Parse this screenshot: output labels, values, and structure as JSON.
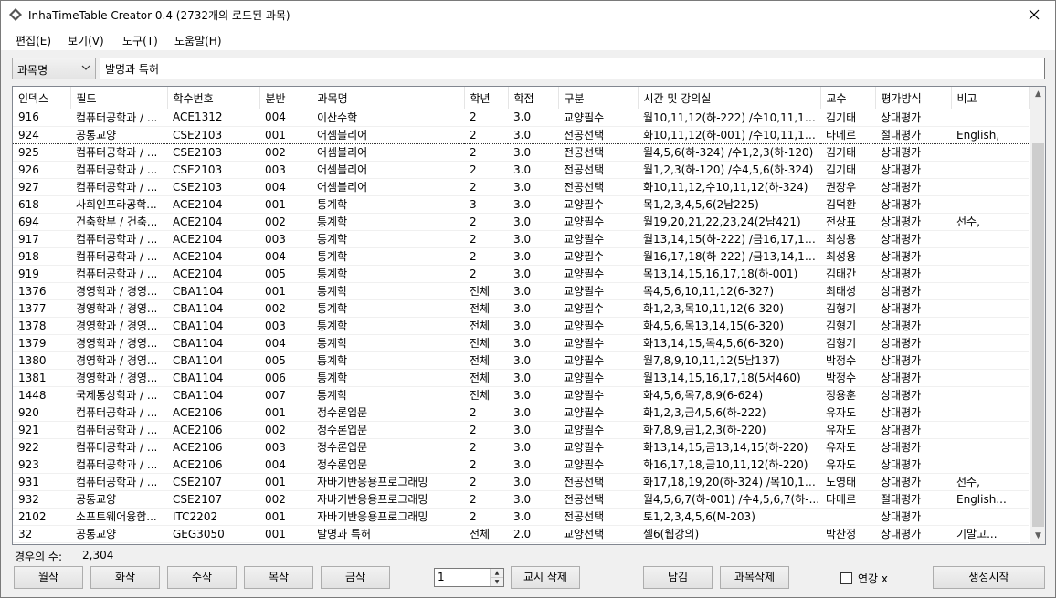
{
  "window": {
    "title": "InhaTimeTable Creator 0.4 (2732개의 로드된 과목)"
  },
  "menu": [
    "편집(E)",
    "보기(V)",
    "도구(T)",
    "도움말(H)"
  ],
  "search": {
    "field": "과목명",
    "value": "발명과 특허"
  },
  "table": {
    "columns": [
      "인덱스",
      "필드",
      "학수번호",
      "분반",
      "과목명",
      "학년",
      "학점",
      "구분",
      "시간 및 강의실",
      "교수",
      "평가방식",
      "비고"
    ],
    "rows": [
      [
        "916",
        "컴퓨터공학과 / ...",
        "ACE1312",
        "004",
        "이산수학",
        "2",
        "3.0",
        "교양필수",
        "월10,11,12(하-222) /수10,11,12(...",
        "김기태",
        "상대평가",
        ""
      ],
      [
        "924",
        "공통교양",
        "CSE2103",
        "001",
        "어셈블리어",
        "2",
        "3.0",
        "전공선택",
        "화10,11,12(하-001) /수10,11,12(...",
        "타메르",
        "절대평가",
        "English,"
      ],
      [
        "925",
        "컴퓨터공학과 / ...",
        "CSE2103",
        "002",
        "어셈블리어",
        "2",
        "3.0",
        "전공선택",
        "월4,5,6(하-324) /수1,2,3(하-120)",
        "김기태",
        "상대평가",
        ""
      ],
      [
        "926",
        "컴퓨터공학과 / ...",
        "CSE2103",
        "003",
        "어셈블리어",
        "2",
        "3.0",
        "전공선택",
        "월1,2,3(하-120) /수4,5,6(하-324)",
        "김기태",
        "상대평가",
        ""
      ],
      [
        "927",
        "컴퓨터공학과 / ...",
        "CSE2103",
        "004",
        "어셈블리어",
        "2",
        "3.0",
        "전공선택",
        "화10,11,12,수10,11,12(하-324)",
        "권장우",
        "상대평가",
        ""
      ],
      [
        "618",
        "사회인프라공학...",
        "ACE2104",
        "001",
        "통계학",
        "3",
        "3.0",
        "교양필수",
        "목1,2,3,4,5,6(2남225)",
        "김덕환",
        "상대평가",
        ""
      ],
      [
        "694",
        "건축학부 / 건축...",
        "ACE2104",
        "002",
        "통계학",
        "2",
        "3.0",
        "교양필수",
        "월19,20,21,22,23,24(2남421)",
        "전상표",
        "상대평가",
        "선수,"
      ],
      [
        "917",
        "컴퓨터공학과 / ...",
        "ACE2104",
        "003",
        "통계학",
        "2",
        "3.0",
        "교양필수",
        "월13,14,15(하-222) /금16,17,18(...",
        "최성용",
        "상대평가",
        ""
      ],
      [
        "918",
        "컴퓨터공학과 / ...",
        "ACE2104",
        "004",
        "통계학",
        "2",
        "3.0",
        "교양필수",
        "월16,17,18(하-222) /금13,14,15(...",
        "최성용",
        "상대평가",
        ""
      ],
      [
        "919",
        "컴퓨터공학과 / ...",
        "ACE2104",
        "005",
        "통계학",
        "2",
        "3.0",
        "교양필수",
        "목13,14,15,16,17,18(하-001)",
        "김태간",
        "상대평가",
        ""
      ],
      [
        "1376",
        "경영학과 / 경영...",
        "CBA1104",
        "001",
        "통계학",
        "전체",
        "3.0",
        "교양필수",
        "목4,5,6,10,11,12(6-327)",
        "최태성",
        "상대평가",
        ""
      ],
      [
        "1377",
        "경영학과 / 경영...",
        "CBA1104",
        "002",
        "통계학",
        "전체",
        "3.0",
        "교양필수",
        "화1,2,3,목10,11,12(6-320)",
        "김형기",
        "상대평가",
        ""
      ],
      [
        "1378",
        "경영학과 / 경영...",
        "CBA1104",
        "003",
        "통계학",
        "전체",
        "3.0",
        "교양필수",
        "화4,5,6,목13,14,15(6-320)",
        "김형기",
        "상대평가",
        ""
      ],
      [
        "1379",
        "경영학과 / 경영...",
        "CBA1104",
        "004",
        "통계학",
        "전체",
        "3.0",
        "교양필수",
        "화13,14,15,목4,5,6(6-320)",
        "김형기",
        "상대평가",
        ""
      ],
      [
        "1380",
        "경영학과 / 경영...",
        "CBA1104",
        "005",
        "통계학",
        "전체",
        "3.0",
        "교양필수",
        "월7,8,9,10,11,12(5남137)",
        "박정수",
        "상대평가",
        ""
      ],
      [
        "1381",
        "경영학과 / 경영...",
        "CBA1104",
        "006",
        "통계학",
        "전체",
        "3.0",
        "교양필수",
        "월13,14,15,16,17,18(5서460)",
        "박정수",
        "상대평가",
        ""
      ],
      [
        "1448",
        "국제통상학과 / ...",
        "CBA1104",
        "007",
        "통계학",
        "전체",
        "3.0",
        "교양필수",
        "화4,5,6,목7,8,9(6-624)",
        "정용훈",
        "상대평가",
        ""
      ],
      [
        "920",
        "컴퓨터공학과 / ...",
        "ACE2106",
        "001",
        "정수론입문",
        "2",
        "3.0",
        "교양필수",
        "화1,2,3,금4,5,6(하-222)",
        "유자도",
        "상대평가",
        ""
      ],
      [
        "921",
        "컴퓨터공학과 / ...",
        "ACE2106",
        "002",
        "정수론입문",
        "2",
        "3.0",
        "교양필수",
        "화7,8,9,금1,2,3(하-220)",
        "유자도",
        "상대평가",
        ""
      ],
      [
        "922",
        "컴퓨터공학과 / ...",
        "ACE2106",
        "003",
        "정수론입문",
        "2",
        "3.0",
        "교양필수",
        "화13,14,15,금13,14,15(하-220)",
        "유자도",
        "상대평가",
        ""
      ],
      [
        "923",
        "컴퓨터공학과 / ...",
        "ACE2106",
        "004",
        "정수론입문",
        "2",
        "3.0",
        "교양필수",
        "화16,17,18,금10,11,12(하-220)",
        "유자도",
        "상대평가",
        ""
      ],
      [
        "931",
        "컴퓨터공학과 / ...",
        "CSE2107",
        "001",
        "자바기반응용프로그래밍",
        "2",
        "3.0",
        "전공선택",
        "화17,18,19,20(하-324) /목10,11,...",
        "노영태",
        "상대평가",
        "선수,"
      ],
      [
        "932",
        "공통교양",
        "CSE2107",
        "002",
        "자바기반응용프로그래밍",
        "2",
        "3.0",
        "전공선택",
        "월4,5,6,7(하-001) /수4,5,6,7(하-...",
        "타메르",
        "절대평가",
        "English..."
      ],
      [
        "2102",
        "소프트웨어융합...",
        "ITC2202",
        "001",
        "자바기반응용프로그래밍",
        "2",
        "3.0",
        "전공선택",
        "토1,2,3,4,5,6(M-203)",
        "",
        "상대평가",
        ""
      ],
      [
        "32",
        "공통교양",
        "GEG3050",
        "001",
        "발명과 특허",
        "전체",
        "2.0",
        "교양선택",
        "셀6(웹강의)",
        "박찬정",
        "상대평가",
        "기말고..."
      ]
    ]
  },
  "status": {
    "count_label": "경우의 수:",
    "count_value": "2,304"
  },
  "buttons": {
    "mon": "월삭",
    "tue": "화삭",
    "wed": "수삭",
    "thu": "목삭",
    "fri": "금삭",
    "period_delete": "교시 삭제",
    "keep": "남김",
    "course_delete": "과목삭제",
    "generate": "생성시작"
  },
  "spinner": {
    "value": "1"
  },
  "option": {
    "label": "연강 x",
    "checked": false
  }
}
